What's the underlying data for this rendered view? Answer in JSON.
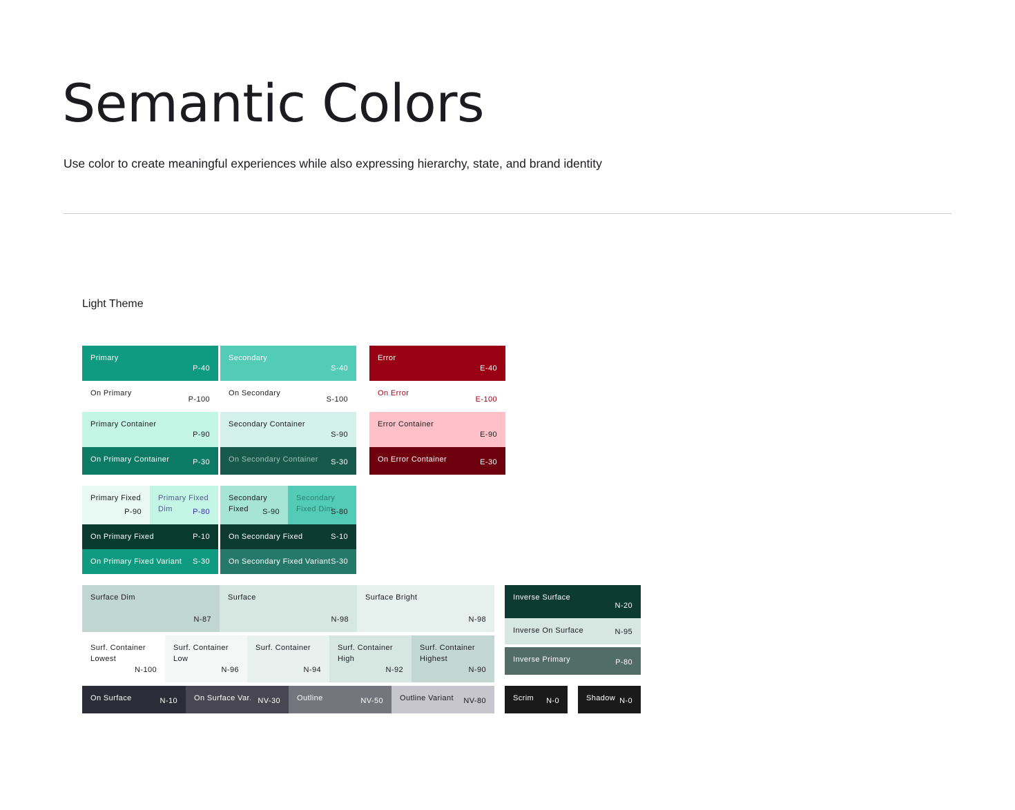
{
  "header": {
    "title": "Semantic Colors",
    "subtitle": "Use color to create meaningful experiences while also expressing hierarchy, state, and brand identity"
  },
  "section": {
    "title": "Light Theme"
  },
  "tiles": {
    "primary": {
      "name": "Primary",
      "tone": "P-40",
      "bg": "#0f9b81",
      "fg": "#ffffff"
    },
    "on_primary": {
      "name": "On Primary",
      "tone": "P-100",
      "bg": "#ffffff",
      "fg": "#1c1b1f"
    },
    "primary_container": {
      "name": "Primary Container",
      "tone": "P-90",
      "bg": "#c3f6e5",
      "fg": "#1c1b1f"
    },
    "on_primary_container": {
      "name": "On Primary Container",
      "tone": "P-30",
      "bg": "#0c7a64",
      "fg": "#ffffff"
    },
    "secondary": {
      "name": "Secondary",
      "tone": "S-40",
      "bg": "#52cbb7",
      "fg": "#ffffff"
    },
    "on_secondary": {
      "name": "On Secondary",
      "tone": "S-100",
      "bg": "#ffffff",
      "fg": "#1c1b1f"
    },
    "secondary_container": {
      "name": "Secondary Container",
      "tone": "S-90",
      "bg": "#d5f1ec",
      "fg": "#1c1b1f"
    },
    "on_secondary_container": {
      "name": "On Secondary Container",
      "tone": "S-30",
      "bg": "#17594c",
      "fg": "#ffffff",
      "name_fg": "#9ec2ba"
    },
    "error": {
      "name": "Error",
      "tone": "E-40",
      "bg": "#9a0013",
      "fg": "#ffffff"
    },
    "on_error": {
      "name": "On Error",
      "tone": "E-100",
      "bg": "#ffffff",
      "fg": "#9a0013"
    },
    "error_container": {
      "name": "Error Container",
      "tone": "E-90",
      "bg": "#ffc1c7",
      "fg": "#1c1b1f"
    },
    "on_error_container": {
      "name": "On Error Container",
      "tone": "E-30",
      "bg": "#6f000e",
      "fg": "#ffffff"
    },
    "primary_fixed": {
      "name": "Primary Fixed",
      "tone": "P-90",
      "bg": "#e8f8f2",
      "fg": "#1c1b1f"
    },
    "primary_fixed_dim": {
      "name": "Primary Fixed\nDim",
      "tone": "P-80",
      "bg": "#c3f6e5",
      "fg": "#4f5a8a",
      "tone_fg": "#3d2aa8"
    },
    "secondary_fixed": {
      "name": "Secondary\nFixed",
      "tone": "S-90",
      "bg": "#a6e4d7",
      "fg": "#1c1b1f"
    },
    "secondary_fixed_dim": {
      "name": "Secondary\nFixed Dim",
      "tone": "S-80",
      "bg": "#52cbb7",
      "fg": "#1c1b1f",
      "name_fg": "#2f7f70"
    },
    "on_primary_fixed": {
      "name": "On Primary Fixed",
      "tone": "P-10",
      "bg": "#083a2e",
      "fg": "#ffffff"
    },
    "on_secondary_fixed": {
      "name": "On Secondary Fixed",
      "tone": "S-10",
      "bg": "#0d3a31",
      "fg": "#ffffff"
    },
    "on_primary_fixed_variant": {
      "name": "On Primary Fixed Variant",
      "tone": "S-30",
      "bg": "#0f9b81",
      "fg": "#ffffff"
    },
    "on_secondary_fixed_variant": {
      "name": "On Secondary Fixed Variant",
      "tone": "S-30",
      "bg": "#26796a",
      "fg": "#ffffff"
    },
    "surface_dim": {
      "name": "Surface Dim",
      "tone": "N-87",
      "bg": "#c0d6d0",
      "fg": "#1c1b1f"
    },
    "surface": {
      "name": "Surface",
      "tone": "N-98",
      "bg": "#d6e6e1",
      "fg": "#1c1b1f"
    },
    "surface_bright": {
      "name": "Surface Bright",
      "tone": "N-98",
      "bg": "#e6f1ee",
      "fg": "#1c1b1f"
    },
    "surf_container_lowest": {
      "name": "Surf. Container\nLowest",
      "tone": "N-100",
      "bg": "#ffffff",
      "fg": "#1c1b1f"
    },
    "surf_container_low": {
      "name": "Surf. Container\nLow",
      "tone": "N-96",
      "bg": "#f3f8f6",
      "fg": "#1c1b1f"
    },
    "surf_container": {
      "name": "Surf. Container",
      "tone": "N-94",
      "bg": "#e8f1ee",
      "fg": "#1c1b1f"
    },
    "surf_container_high": {
      "name": "Surf. Container\nHigh",
      "tone": "N-92",
      "bg": "#d6e6e1",
      "fg": "#1c1b1f"
    },
    "surf_container_highest": {
      "name": "Surf. Container\nHighest",
      "tone": "N-90",
      "bg": "#c3d8d2",
      "fg": "#1c1b1f"
    },
    "on_surface": {
      "name": "On Surface",
      "tone": "N-10",
      "bg": "#2c2b38",
      "fg": "#ffffff"
    },
    "on_surface_var": {
      "name": "On Surface Var.",
      "tone": "NV-30",
      "bg": "#474652",
      "fg": "#ffffff"
    },
    "outline": {
      "name": "Outline",
      "tone": "NV-50",
      "bg": "#75757d",
      "fg": "#ffffff"
    },
    "outline_variant": {
      "name": "Outline Variant",
      "tone": "NV-80",
      "bg": "#c7c6cc",
      "fg": "#1c1b1f"
    },
    "inverse_surface": {
      "name": "Inverse Surface",
      "tone": "N-20",
      "bg": "#0d3a31",
      "fg": "#ffffff"
    },
    "inverse_on_surface": {
      "name": "Inverse On Surface",
      "tone": "N-95",
      "bg": "#d6e6e1",
      "fg": "#1c1b1f"
    },
    "inverse_primary": {
      "name": "Inverse Primary",
      "tone": "P-80",
      "bg": "#516d66",
      "fg": "#ffffff"
    },
    "scrim": {
      "name": "Scrim",
      "tone": "N-0",
      "bg": "#1a1a1a",
      "fg": "#ffffff"
    },
    "shadow": {
      "name": "Shadow",
      "tone": "N-0",
      "bg": "#1a1a1a",
      "fg": "#ffffff"
    }
  }
}
